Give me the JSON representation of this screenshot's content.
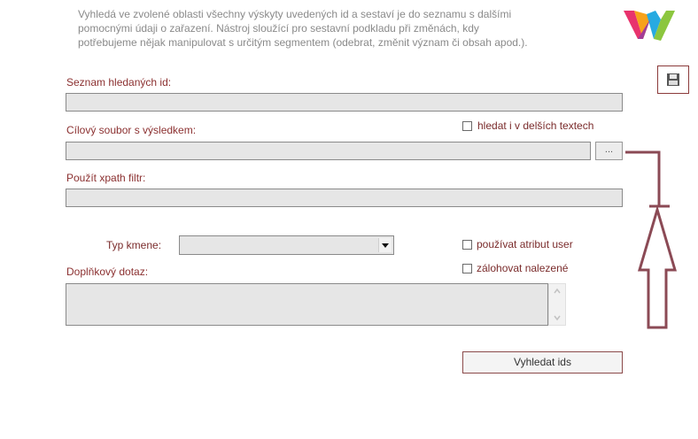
{
  "description": {
    "line1": "Vyhledá ve zvolené oblasti všechny výskyty uvedených id a sestaví je do seznamu s dalšími",
    "line2": "pomocnými údaji o zařazení. Nástroj sloužící pro sestavní podkladu při změnách, kdy",
    "line3": "potřebujeme nějak manipulovat s určitým segmentem (odebrat, změnit význam či obsah apod.)."
  },
  "fields": {
    "seznam_label": "Seznam hledaných id:",
    "seznam_value": "",
    "cilovy_label": "Cílový soubor s výsledkem:",
    "cilovy_value": "",
    "browse_label": "...",
    "xpath_label": "Použít xpath filtr:",
    "xpath_value": "",
    "typ_label": "Typ kmene:",
    "typ_value": "",
    "doplnkovy_label": "Doplňkový dotaz:",
    "doplnkovy_value": ""
  },
  "options": {
    "hledat_label": "hledat i v delších textech",
    "hledat_checked": false,
    "atribut_label": "používat atribut user",
    "atribut_checked": false,
    "zalohovat_label": "zálohovat nalezené",
    "zalohovat_checked": false
  },
  "actions": {
    "search_label": "Vyhledat ids"
  },
  "icons": {
    "logo": "w-logo-icon",
    "save": "floppy-disk-icon",
    "dropdown": "chevron-down-icon",
    "annotation": "arrow-annotation"
  },
  "colors": {
    "label": "#8b3030",
    "annotation": "#8b4a55",
    "field_bg": "#e6e6e6"
  }
}
